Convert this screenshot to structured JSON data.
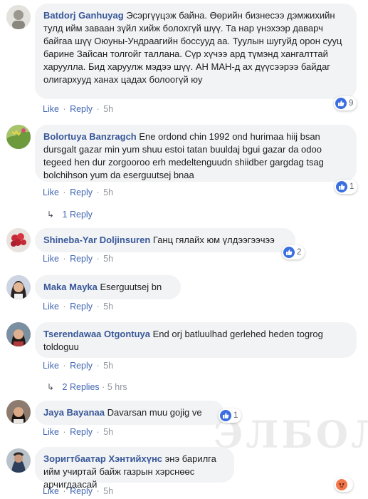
{
  "colors": {
    "author": "#385898",
    "link": "#4267b2",
    "bubble": "#f2f3f5",
    "meta": "#90949c",
    "like": "#3b6fe0",
    "angry": "#f2784b"
  },
  "labels": {
    "like": "Like",
    "reply": "Reply",
    "dot": "·"
  },
  "watermark": "ЭЛБОЛДОР",
  "comments": [
    {
      "author": "Batdorj Ganhuyag",
      "text": "Эсэргүүцэж байна. Өөрийн бизнесээ дэмжихийн тулд ийм заваан зүйл хийж болохгүй шүү. Та нар үнэхээр даварч байгаа шүү Оюуны-Ундраагийн боссууд аа. Туулын шугуйд орон сууц барине Зайсан толгойг таллана. Сүр хүчээ ард түмэнд хангалттай харуулла. Бид харуулж мэдээ шүү. АН МАН-д ах дүүсээрээ байдаг олигархууд ханах цадах болоогүй юу",
      "time": "5h",
      "reactions": {
        "icon": "like-icon",
        "count": "9"
      }
    },
    {
      "author": "Bolortuya Banzragch",
      "text": "Ene ordond chin 1992 ond hurimaa hiij bsan dursgalt gazar min yum shuu estoi tatan buuldaj bgui gazar da odoo tegeed hen dur zorgooroo erh medeltenguudn shiidber gargdag tsag bolchihson yum da eserguutsej bnaa",
      "time": "5h",
      "reactions": {
        "icon": "like-icon",
        "count": "1"
      },
      "replies": {
        "label": "1 Reply",
        "meta": ""
      }
    },
    {
      "author": "Shineba-Yar Doljinsuren",
      "text": "Ганц гялайх юм үлдээгээчээ",
      "time": "5h",
      "reactions": {
        "icon": "like-icon",
        "count": "2"
      }
    },
    {
      "author": "Maka Mayka",
      "text": "Eserguutsej bn",
      "time": "5h"
    },
    {
      "author": "Tserendawaa Otgontuya",
      "text": "End orj batluulhad gerlehed heden togrog toldoguu",
      "time": "5h",
      "replies": {
        "label": "2 Replies",
        "meta": "5 hrs"
      }
    },
    {
      "author": "Jaya Bayanaa",
      "text": "Davarsan muu gojig ve",
      "time": "5h",
      "reactions": {
        "icon": "like-icon",
        "count": "1"
      }
    },
    {
      "author": "Зоригтбаатар Хэнтийхүнс",
      "text": "энэ барилга ийм учиртай байж газрын хэрснөөс арчигдаасай",
      "time": "5h",
      "reactions": {
        "icon": "angry-icon",
        "count": ""
      }
    }
  ]
}
